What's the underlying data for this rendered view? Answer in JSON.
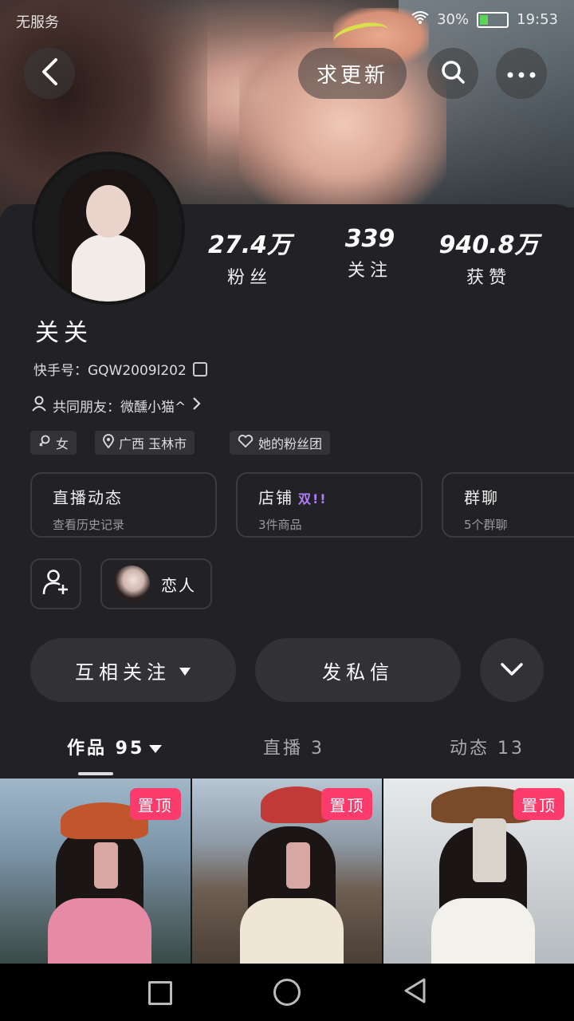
{
  "status_bar": {
    "carrier": "无服务",
    "battery_percent": "30%",
    "time": "19:53"
  },
  "top_bar": {
    "refresh_label": "求更新"
  },
  "profile": {
    "name": "关关",
    "kuaishou_id": "快手号：GQW2009l202",
    "mutual_friends": "共同朋友：微醺小猫^",
    "stats": [
      {
        "value": "27.4万",
        "label": "粉丝"
      },
      {
        "value": "339",
        "label": "关注"
      },
      {
        "value": "940.8万",
        "label": "获赞"
      }
    ],
    "tags": [
      "女",
      "广西 玉林市",
      "她的粉丝团"
    ]
  },
  "features": [
    {
      "title": "直播动态",
      "sub": "查看历史记录",
      "badge": ""
    },
    {
      "title": "店铺",
      "sub": "3件商品",
      "badge": "双!!"
    },
    {
      "title": "群聊",
      "sub": "5个群聊",
      "badge": ""
    }
  ],
  "lover_label": "恋人",
  "actions": {
    "mutual_follow": "互相关注",
    "send_message": "发私信"
  },
  "tabs": [
    {
      "label": "作品 95"
    },
    {
      "label": "直播 3"
    },
    {
      "label": "动态 13"
    }
  ],
  "grid": [
    {
      "badge": "置顶"
    },
    {
      "badge": "置顶"
    },
    {
      "badge": "置顶"
    }
  ]
}
